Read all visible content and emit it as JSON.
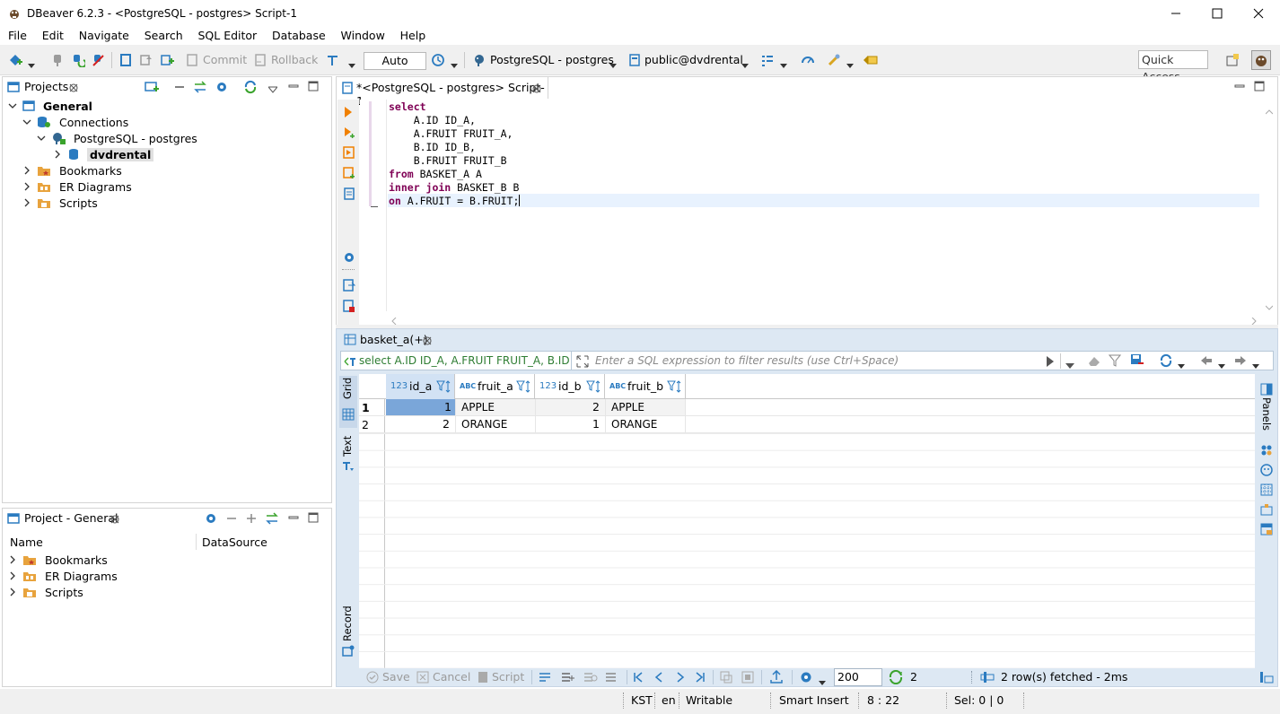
{
  "window": {
    "title": "DBeaver 6.2.3 - <PostgreSQL - postgres> Script-1"
  },
  "menu": [
    "File",
    "Edit",
    "Navigate",
    "Search",
    "SQL Editor",
    "Database",
    "Window",
    "Help"
  ],
  "toolbar": {
    "commit": "Commit",
    "rollback": "Rollback",
    "mode": "Auto",
    "connection": "PostgreSQL - postgres",
    "schema": "public@dvdrental",
    "quick_access": "Quick Access"
  },
  "projects_panel": {
    "tab": "Projects",
    "tree": {
      "general": "General",
      "connections": "Connections",
      "postgres": "PostgreSQL - postgres",
      "dvdrental": "dvdrental",
      "bookmarks": "Bookmarks",
      "er_diagrams": "ER Diagrams",
      "scripts": "Scripts"
    }
  },
  "project_general_panel": {
    "tab": "Project - General",
    "col_name": "Name",
    "col_datasource": "DataSource",
    "items": [
      "Bookmarks",
      "ER Diagrams",
      "Scripts"
    ]
  },
  "editor": {
    "tab": "*<PostgreSQL - postgres> Script-1",
    "lines": [
      {
        "kw": "select",
        "rest": ""
      },
      {
        "kw": "",
        "rest": "    A.ID ID_A,"
      },
      {
        "kw": "",
        "rest": "    A.FRUIT FRUIT_A,"
      },
      {
        "kw": "",
        "rest": "    B.ID ID_B,"
      },
      {
        "kw": "",
        "rest": "    B.FRUIT FRUIT_B"
      },
      {
        "kw": "from",
        "rest": " BASKET_A A"
      },
      {
        "kw": "inner join",
        "rest": " BASKET_B B"
      },
      {
        "kw": "on",
        "rest": " A.FRUIT = B.FRUIT;"
      }
    ]
  },
  "results": {
    "tab": "basket_a(+)",
    "query": "select A.ID ID_A, A.FRUIT FRUIT_A, B.ID ID_I",
    "filter_placeholder": "Enter a SQL expression to filter results (use Ctrl+Space)",
    "side_tabs": {
      "grid": "Grid",
      "text": "Text",
      "record": "Record",
      "panels": "Panels"
    },
    "columns": [
      {
        "type": "123",
        "name": "id_a"
      },
      {
        "type": "ABC",
        "name": "fruit_a"
      },
      {
        "type": "123",
        "name": "id_b"
      },
      {
        "type": "ABC",
        "name": "fruit_b"
      }
    ],
    "rows": [
      {
        "num": "1",
        "id_a": "1",
        "fruit_a": "APPLE",
        "id_b": "2",
        "fruit_b": "APPLE"
      },
      {
        "num": "2",
        "id_a": "2",
        "fruit_a": "ORANGE",
        "id_b": "1",
        "fruit_b": "ORANGE"
      }
    ],
    "bottom": {
      "save": "Save",
      "cancel": "Cancel",
      "script": "Script",
      "fetch_size": "200",
      "refresh_count": "2",
      "status": "2 row(s) fetched - 2ms"
    }
  },
  "statusbar": {
    "timezone": "KST",
    "locale": "en",
    "writable": "Writable",
    "insert_mode": "Smart Insert",
    "position": "8 : 22",
    "selection": "Sel: 0 | 0"
  }
}
